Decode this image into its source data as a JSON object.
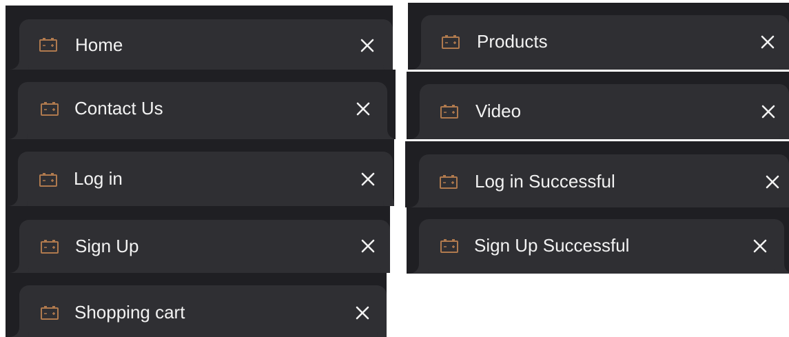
{
  "tabs": [
    {
      "label": "Home",
      "close_glyph": "×",
      "icon": "battery-icon"
    },
    {
      "label": "Products",
      "close_glyph": "×",
      "icon": "battery-icon"
    },
    {
      "label": "Contact Us",
      "close_glyph": "×",
      "icon": "battery-icon"
    },
    {
      "label": "Video",
      "close_glyph": "×",
      "icon": "battery-icon"
    },
    {
      "label": "Log in",
      "close_glyph": "×",
      "icon": "battery-icon"
    },
    {
      "label": "Log in Successful",
      "close_glyph": "×",
      "icon": "battery-icon"
    },
    {
      "label": "Sign Up",
      "close_glyph": "×",
      "icon": "battery-icon"
    },
    {
      "label": "Sign Up Successful",
      "close_glyph": "×",
      "icon": "battery-icon"
    },
    {
      "label": "Shopping cart",
      "close_glyph": "×",
      "icon": "battery-icon"
    }
  ],
  "colors": {
    "strip": "#1f1f23",
    "tab": "#2f2f33",
    "text": "#f2f2f2",
    "icon": "#b07a4e"
  }
}
